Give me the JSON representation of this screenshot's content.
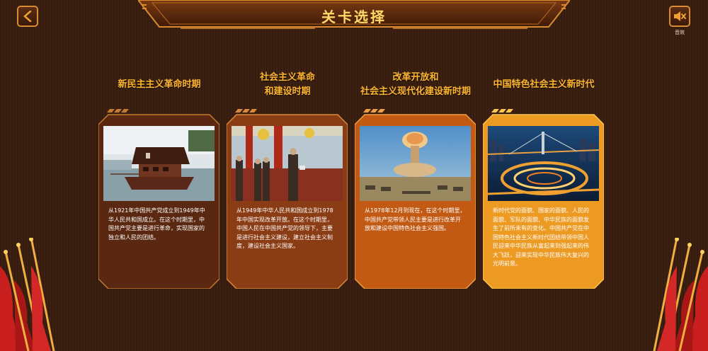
{
  "page": {
    "title": "关卡选择"
  },
  "toolbar": {
    "sound_label": "音效"
  },
  "levels": [
    {
      "heading_lines": [
        "新民主主义革命时期"
      ],
      "description": "从1921年中国共产党成立到1949年中华人民共和国成立。在这个时期里，中国共产党主要是进行革命，实现国家的独立和人民的团结。"
    },
    {
      "heading_lines": [
        "社会主义革命",
        "和建设时期"
      ],
      "description": "从1949年中华人民共和国成立到1978年中国实现改革开放。在这个时期里，中国人民在中国共产党的领导下，主要是进行社会主义建设，建立社会主义制度，建设社会主义国家。"
    },
    {
      "heading_lines": [
        "改革开放和",
        "社会主义现代化建设新时期"
      ],
      "description": "从1978年12月到现在，在这个时期里，中国共产党带领人民主要是进行改革开放和建设中国特色社会主义强国。"
    },
    {
      "heading_lines": [
        "中国特色社会主义新时代"
      ],
      "description": "新时代党的面貌、国家的面貌、人民的面貌、军队的面貌、中华民族的面貌发生了前所未有的变化。中国共产党在中国特色社会主义新时代团结带领中国人民迎来中华民族从富起来到强起来的伟大飞跃，迎来实现中华民族伟大复兴的光明前景。"
    }
  ],
  "colors": {
    "title": "#ffd86a",
    "heading": "#ffb62e",
    "card1": "#5a2810",
    "card2": "#8a3c14",
    "card3": "#c25a14",
    "card4": "#ec9a22"
  }
}
